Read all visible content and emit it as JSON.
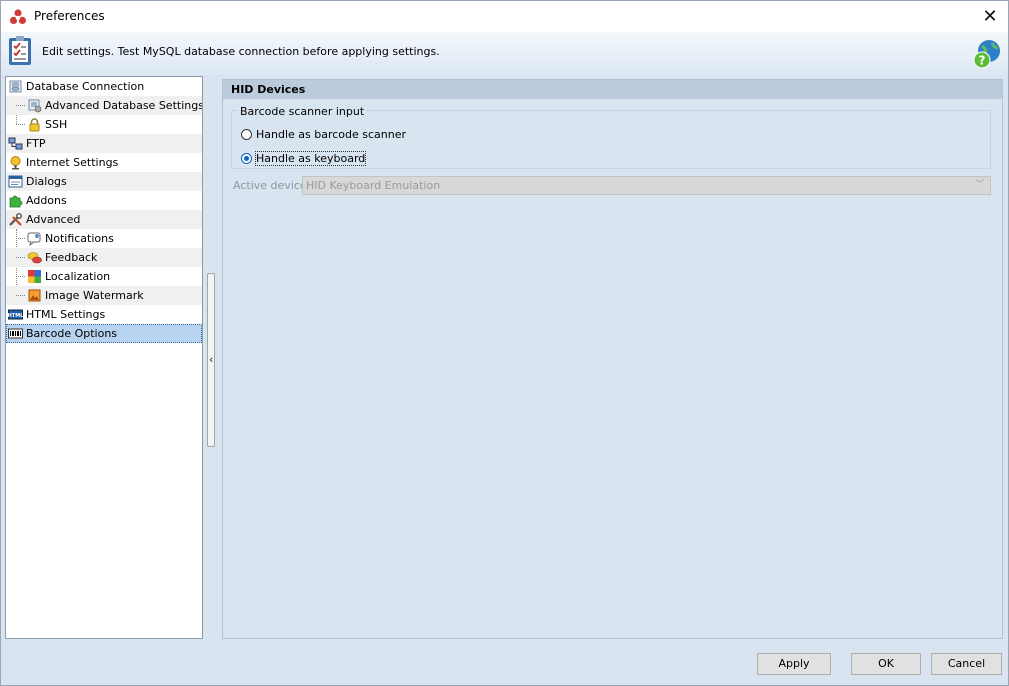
{
  "window": {
    "title": "Preferences",
    "close_label": "✕"
  },
  "header": {
    "text": "Edit settings. Test MySQL database connection before applying settings."
  },
  "tree": [
    {
      "name": "database-connection",
      "label": "Database Connection",
      "level": 0,
      "icon": "database-icon"
    },
    {
      "name": "advanced-database-settings",
      "label": "Advanced Database Settings",
      "level": 1,
      "icon": "database-settings-icon"
    },
    {
      "name": "ssh",
      "label": "SSH",
      "level": 1,
      "icon": "lock-icon"
    },
    {
      "name": "ftp",
      "label": "FTP",
      "level": 0,
      "icon": "network-icon"
    },
    {
      "name": "internet-settings",
      "label": "Internet Settings",
      "level": 0,
      "icon": "internet-icon"
    },
    {
      "name": "dialogs",
      "label": "Dialogs",
      "level": 0,
      "icon": "dialog-icon"
    },
    {
      "name": "addons",
      "label": "Addons",
      "level": 0,
      "icon": "puzzle-icon"
    },
    {
      "name": "advanced",
      "label": "Advanced",
      "level": 0,
      "icon": "tools-icon"
    },
    {
      "name": "notifications",
      "label": "Notifications",
      "level": 1,
      "icon": "notification-icon"
    },
    {
      "name": "feedback",
      "label": "Feedback",
      "level": 1,
      "icon": "feedback-icon"
    },
    {
      "name": "localization",
      "label": "Localization",
      "level": 1,
      "icon": "localization-icon"
    },
    {
      "name": "image-watermark",
      "label": "Image Watermark",
      "level": 1,
      "icon": "image-icon"
    },
    {
      "name": "html-settings",
      "label": "HTML Settings",
      "level": 0,
      "icon": "html-icon"
    },
    {
      "name": "barcode-options",
      "label": "Barcode Options",
      "level": 0,
      "icon": "barcode-icon",
      "selected": true
    }
  ],
  "panel": {
    "title": "HID Devices",
    "group_label": "Barcode scanner input",
    "radio_scanner": "Handle as barcode scanner",
    "radio_keyboard": "Handle as keyboard",
    "selected_radio": "keyboard",
    "active_device_label": "Active device",
    "active_device_value": "HID Keyboard Emulation"
  },
  "buttons": {
    "apply": "Apply",
    "ok": "OK",
    "cancel": "Cancel"
  },
  "colors": {
    "accent": "#0b64c6",
    "selection": "#b8d3ef",
    "panel_bg": "#d9e4f1"
  }
}
